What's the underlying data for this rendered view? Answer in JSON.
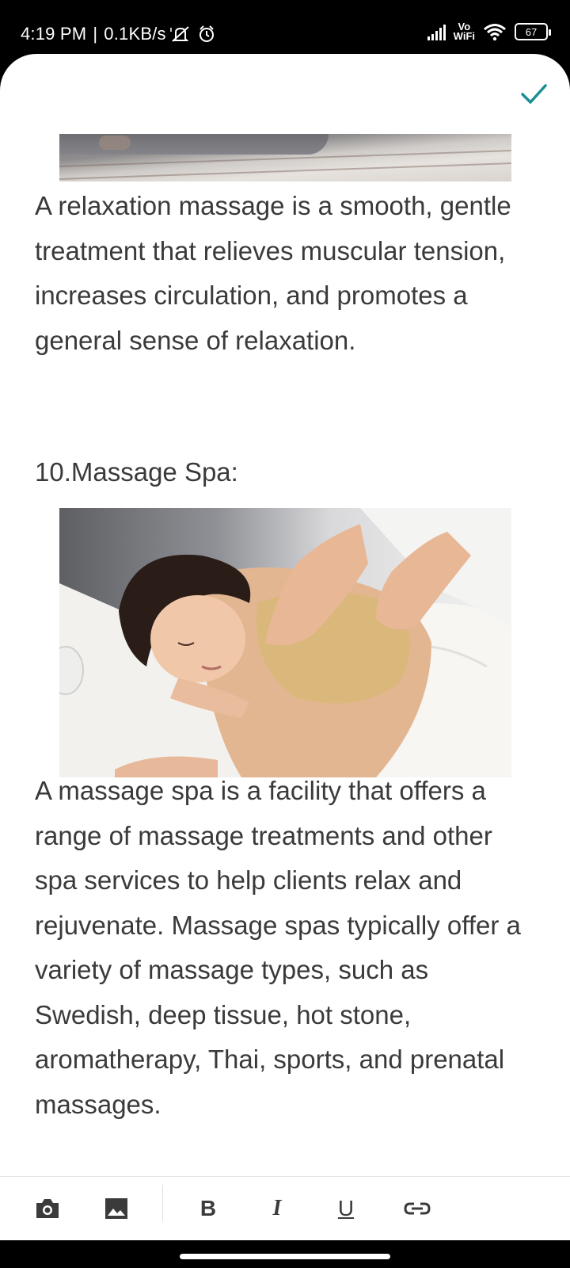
{
  "status_bar": {
    "time": "4:19 PM",
    "separator": "|",
    "net_speed": "0.1KB/s",
    "vowifi_top": "Vo",
    "vowifi_bottom": "WiFi",
    "battery": "67"
  },
  "header": {
    "done_icon": "check-icon"
  },
  "content": {
    "paragraph_1": "A relaxation massage is a smooth, gentle treatment that relieves muscular tension, increases circulation, and promotes a general sense of relaxation.",
    "heading_10": "10.Massage Spa:",
    "paragraph_2": "A massage spa is a facility that offers a range of massage treatments and other spa services to help clients relax and rejuvenate. Massage spas typically offer a variety of massage types, such as Swedish, deep tissue, hot stone, aromatherapy, Thai, sports, and prenatal massages."
  },
  "toolbar": {
    "camera_icon": "camera-icon",
    "image_icon": "image-icon",
    "bold_label": "B",
    "italic_label": "I",
    "underline_label": "U",
    "link_icon": "link-icon"
  },
  "colors": {
    "accent": "#1a8f96",
    "text": "#3a3a3a",
    "background": "#ffffff"
  }
}
